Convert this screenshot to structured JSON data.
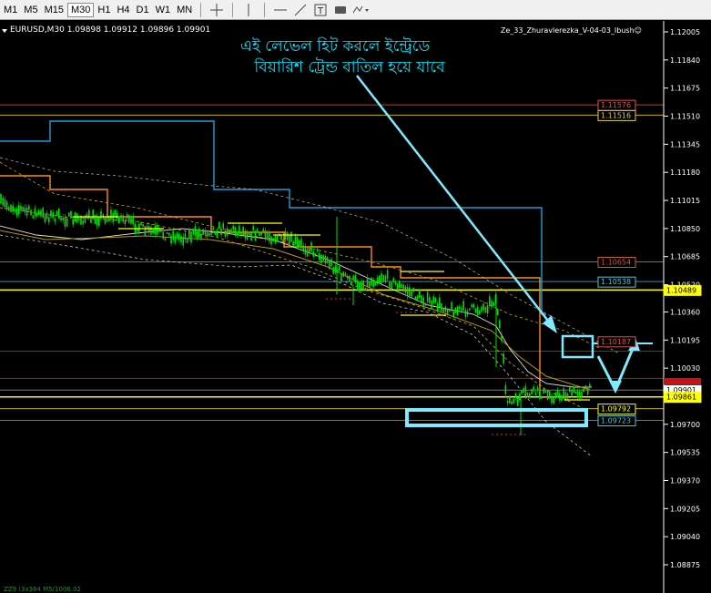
{
  "toolbar": {
    "timeframes": [
      "M1",
      "M5",
      "M15",
      "M30",
      "H1",
      "H4",
      "D1",
      "W1",
      "MN"
    ],
    "active_timeframe": "M30"
  },
  "chart": {
    "info_line": "EURUSD,M30  1.09898 1.09912 1.09896 1.09901",
    "indicator_label": "Ze_33_Zhuravlerezka_V-04-03_Ibush☺",
    "annotation_line1": "এই লেভেল হিট করলে ইন্ট্রেডে",
    "annotation_line2": "বিয়ারিশ ট্রেন্ড বাতিল হয়ে যাবে",
    "bottom_text": "ZZ9 (3x384 M5/1006.02",
    "price_axis": [
      "1.12005",
      "1.11840",
      "1.11675",
      "1.11510",
      "1.11345",
      "1.11180",
      "1.11015",
      "1.10850",
      "1.10685",
      "1.10520",
      "1.10360",
      "1.10195",
      "1.10030",
      "1.09865",
      "1.09700",
      "1.09535",
      "1.09370",
      "1.09205",
      "1.09040",
      "1.08875"
    ],
    "level_labels": [
      {
        "text": "1.11576",
        "color": "#d9534f"
      },
      {
        "text": "1.11516",
        "color": "#e6d22a"
      },
      {
        "text": "1.10654",
        "color": "#c75a3a"
      },
      {
        "text": "1.10538",
        "color": "#4fc3e0"
      },
      {
        "text": "1.10489",
        "color": "#ffff00"
      },
      {
        "text": "1.10187",
        "color": "#d9534f"
      },
      {
        "text": "1.09901",
        "color": "#ffffff"
      },
      {
        "text": "1.09861",
        "color": "#ffff00"
      },
      {
        "text": "1.09792",
        "color": "#ffff00"
      },
      {
        "text": "1.09723",
        "color": "#4fc3e0"
      }
    ],
    "colors": {
      "candles": "#00e000",
      "cyan_line": "#1e9ed8",
      "orange_line": "#ff8c1a",
      "annotation": "#00e5ff",
      "yellow_level": "#ffff00",
      "red_level": "#c0392b",
      "blue_level": "#1f3fc9"
    }
  }
}
